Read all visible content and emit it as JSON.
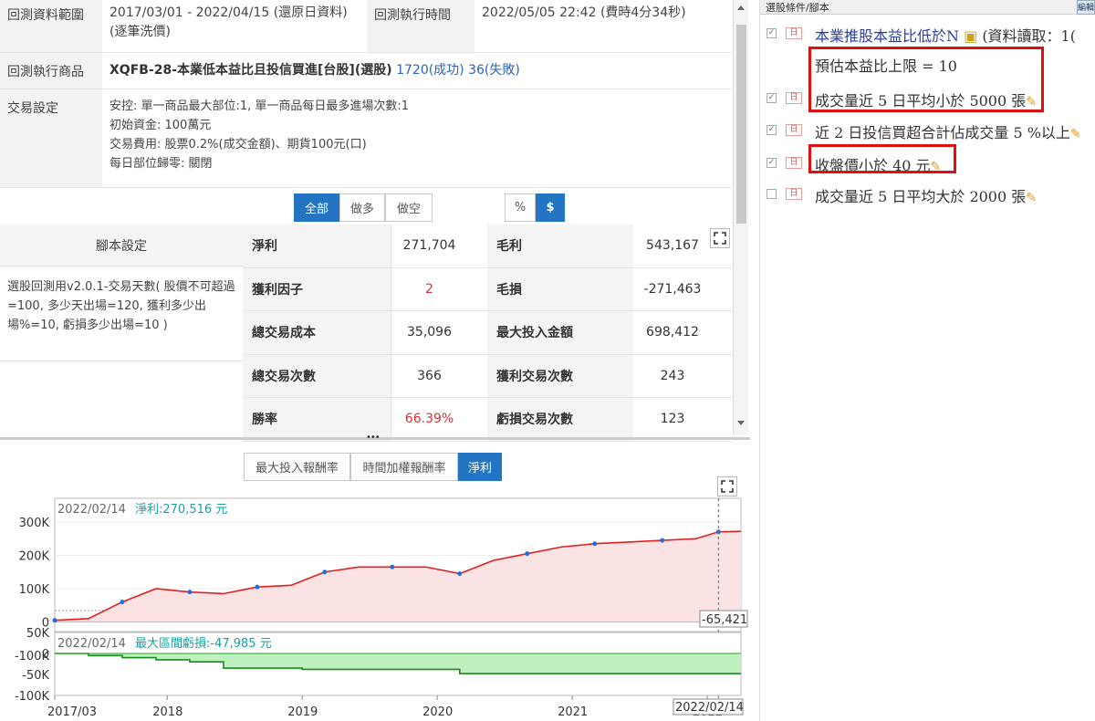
{
  "info": {
    "range_label": "回測資料範圍",
    "range_value": "2017/03/01 - 2022/04/15 (還原日資料) (逐筆洗價)",
    "exec_time_label": "回測執行時間",
    "exec_time_value": "2022/05/05 22:42 (費時4分34秒)",
    "product_label": "回測執行商品",
    "product_name": "XQFB-28-本業低本益比且投信買進[台股](選股)",
    "product_success": "1720(成功)",
    "product_fail": "36(失敗)",
    "trade_label": "交易設定",
    "trade_lines": [
      "安控: 單一商品最大部位:1, 單一商品每日最多進場次數:1",
      "初始資金: 100萬元",
      "交易費用: 股票0.2%(成交金額)、期貨100元(口)",
      "每日部位歸零: 關閉"
    ]
  },
  "direction_buttons": [
    "全部",
    "做多",
    "做空"
  ],
  "unit_buttons": [
    "%",
    "$"
  ],
  "script": {
    "header": "腳本設定",
    "text": "選股回測用v2.0.1-交易天數( 股價不可超過=100, 多少天出場=120, 獲利多少出場%=10, 虧損多少出場=10 )"
  },
  "stats": [
    {
      "label": "淨利",
      "value": "271,704",
      "label2": "毛利",
      "value2": "543,167"
    },
    {
      "label": "獲利因子",
      "value": "2",
      "label2": "毛損",
      "value2": "-271,463"
    },
    {
      "label": "總交易成本",
      "value": "35,096",
      "label2": "最大投入金額",
      "value2": "698,412"
    },
    {
      "label": "總交易次數",
      "value": "366",
      "label2": "獲利交易次數",
      "value2": "243"
    },
    {
      "label": "勝率",
      "value": "66.39%",
      "label2": "虧損交易次數",
      "value2": "123"
    }
  ],
  "chart_tabs": [
    "最大投入報酬率",
    "時間加權報酬率",
    "淨利"
  ],
  "colors": {
    "accent": "#2474c4",
    "red": "#d33333",
    "series_up": "#1f6fe0",
    "series_line": "#e02020",
    "dd_fill": "#bff0bf",
    "dd_line": "#1a8a1a"
  },
  "chart_data": [
    {
      "type": "area",
      "header_date": "2022/02/14",
      "header_label": "淨利:",
      "header_value": "270,516 元",
      "yticks": [
        "300K",
        "200K",
        "100K",
        "0",
        "-100K"
      ],
      "ylim": [
        -100000,
        300000
      ],
      "cursor_value": "-65,421",
      "x": [
        "2017/03",
        "2017/06",
        "2017/09",
        "2017/12",
        "2018/03",
        "2018/06",
        "2018/09",
        "2018/12",
        "2019/03",
        "2019/06",
        "2019/09",
        "2019/12",
        "2020/03",
        "2020/06",
        "2020/09",
        "2020/12",
        "2021/03",
        "2021/06",
        "2021/09",
        "2021/12",
        "2022/02",
        "2022/04"
      ],
      "values": [
        5000,
        10000,
        60000,
        100000,
        90000,
        85000,
        105000,
        110000,
        150000,
        165000,
        165000,
        165000,
        145000,
        185000,
        205000,
        225000,
        235000,
        240000,
        245000,
        250000,
        270516,
        272000
      ]
    },
    {
      "type": "area",
      "header_date": "2022/02/14",
      "header_label": "最大區間虧損:",
      "header_value": "-47,985 元",
      "yticks": [
        "50K",
        "0",
        "-50K",
        "-100K"
      ],
      "ylim": [
        -100000,
        50000
      ],
      "x": [
        "2017/03",
        "2017/06",
        "2017/09",
        "2017/12",
        "2018/03",
        "2018/06",
        "2019/01",
        "2020/03",
        "2022/04"
      ],
      "values": [
        0,
        -5000,
        -10000,
        -15000,
        -20000,
        -35000,
        -38000,
        -47985,
        -47985
      ],
      "xtick_labels": [
        "2017/03",
        "2018",
        "2019",
        "2020",
        "2021",
        "2022"
      ],
      "cursor_date": "2022/02/14"
    }
  ],
  "right_panel": {
    "header": "選股條件/腳本",
    "edit": "編輯",
    "conditions": [
      {
        "text": "本業推股本益比低於N",
        "suffix": "(資料讀取：1(",
        "checked": true,
        "blue": true
      },
      {
        "text": "預估本益比上限 = 10",
        "checked": null,
        "blue": false
      },
      {
        "text": "成交量近 5 日平均小於 5000 張",
        "checked": true,
        "blue": false
      },
      {
        "text": "近 2 日投信買超合計佔成交量 5 %以上",
        "checked": true,
        "blue": false
      },
      {
        "text": "收盤價小於 40 元",
        "checked": true,
        "blue": false
      },
      {
        "text": "成交量近 5 日平均大於 2000 張",
        "checked": false,
        "blue": false
      }
    ]
  }
}
